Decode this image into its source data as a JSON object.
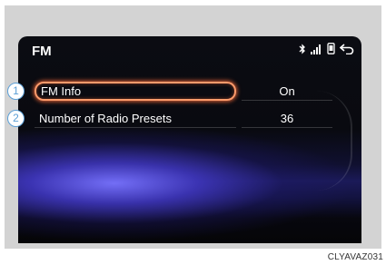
{
  "screen": {
    "title": "FM",
    "icons": [
      "bluetooth-icon",
      "signal-bars-icon",
      "phone-icon",
      "back-icon"
    ]
  },
  "items": [
    {
      "callout": "1",
      "label": "FM Info",
      "value": "On",
      "selected": true
    },
    {
      "callout": "2",
      "label": "Number of Radio Presets",
      "value": "36",
      "selected": false
    }
  ],
  "figure_code": "CLYAVAZ031",
  "colors": {
    "accent_glow": "#ff9b6b",
    "callout_blue": "#5b9fd6"
  }
}
